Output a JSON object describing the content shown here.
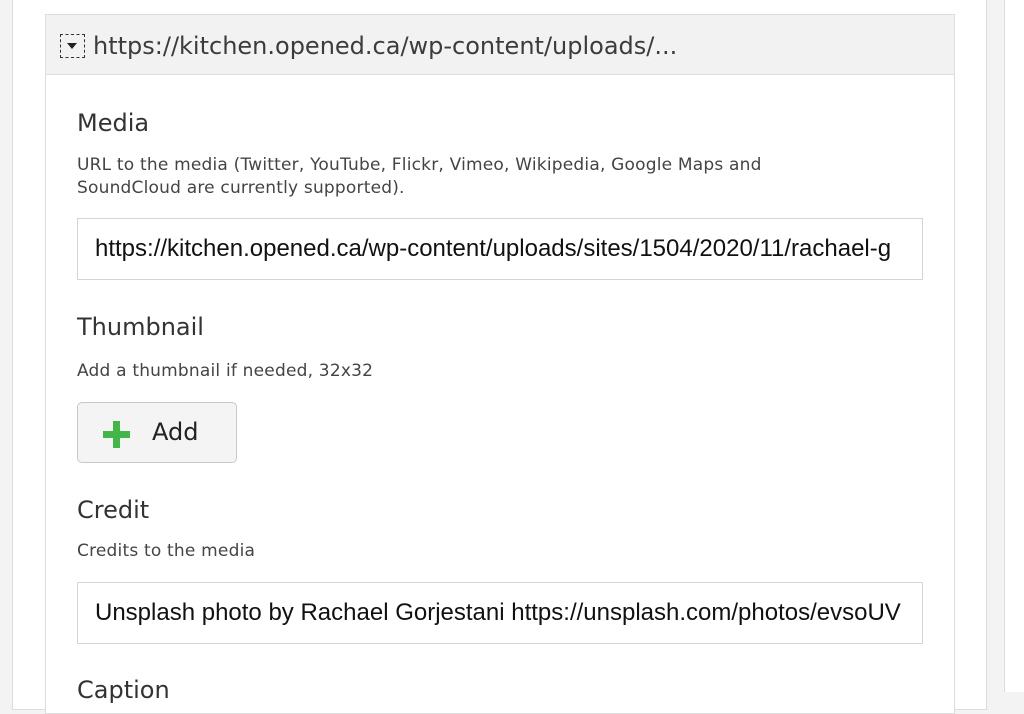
{
  "panel": {
    "header_title": "https://kitchen.opened.ca/wp-content/uploads/..."
  },
  "media": {
    "label": "Media",
    "description": "URL to the media (Twitter, YouTube, Flickr, Vimeo, Wikipedia, Google Maps and SoundCloud are currently supported).",
    "value": "https://kitchen.opened.ca/wp-content/uploads/sites/1504/2020/11/rachael-g"
  },
  "thumbnail": {
    "label": "Thumbnail",
    "description": "Add a thumbnail if needed, 32x32",
    "add_label": "Add"
  },
  "credit": {
    "label": "Credit",
    "description": "Credits to the media",
    "value": "Unsplash photo by Rachael Gorjestani https://unsplash.com/photos/evsoUV"
  },
  "caption": {
    "label": "Caption"
  },
  "icons": {
    "toggle": "chevron-down-icon",
    "add": "plus-icon"
  },
  "colors": {
    "accent_green": "#43b649",
    "header_bg": "#f2f2f2"
  }
}
